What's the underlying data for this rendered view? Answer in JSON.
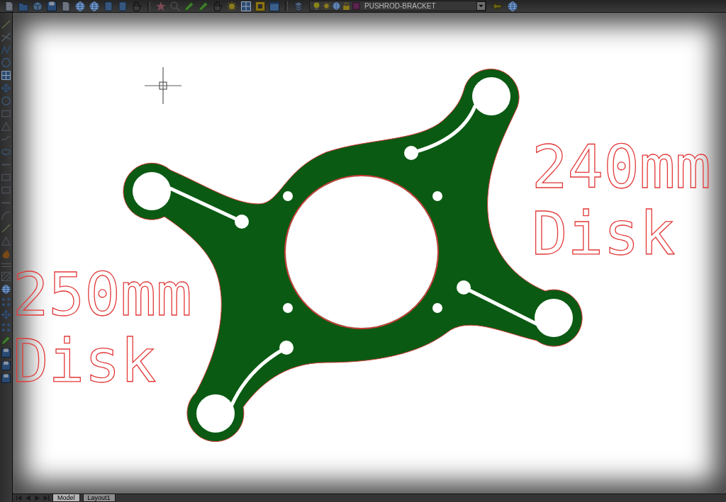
{
  "toolbar": {
    "layer_dropdown": {
      "value": "PUSHROD-BRACKET"
    }
  },
  "drawing": {
    "labels": [
      {
        "lines": [
          "240mm",
          "Disk"
        ]
      },
      {
        "lines": [
          "250mm",
          "Disk"
        ]
      }
    ]
  },
  "layout_tabs": [
    {
      "label": "Model",
      "selected": true
    },
    {
      "label": "Layout1",
      "selected": false
    }
  ]
}
